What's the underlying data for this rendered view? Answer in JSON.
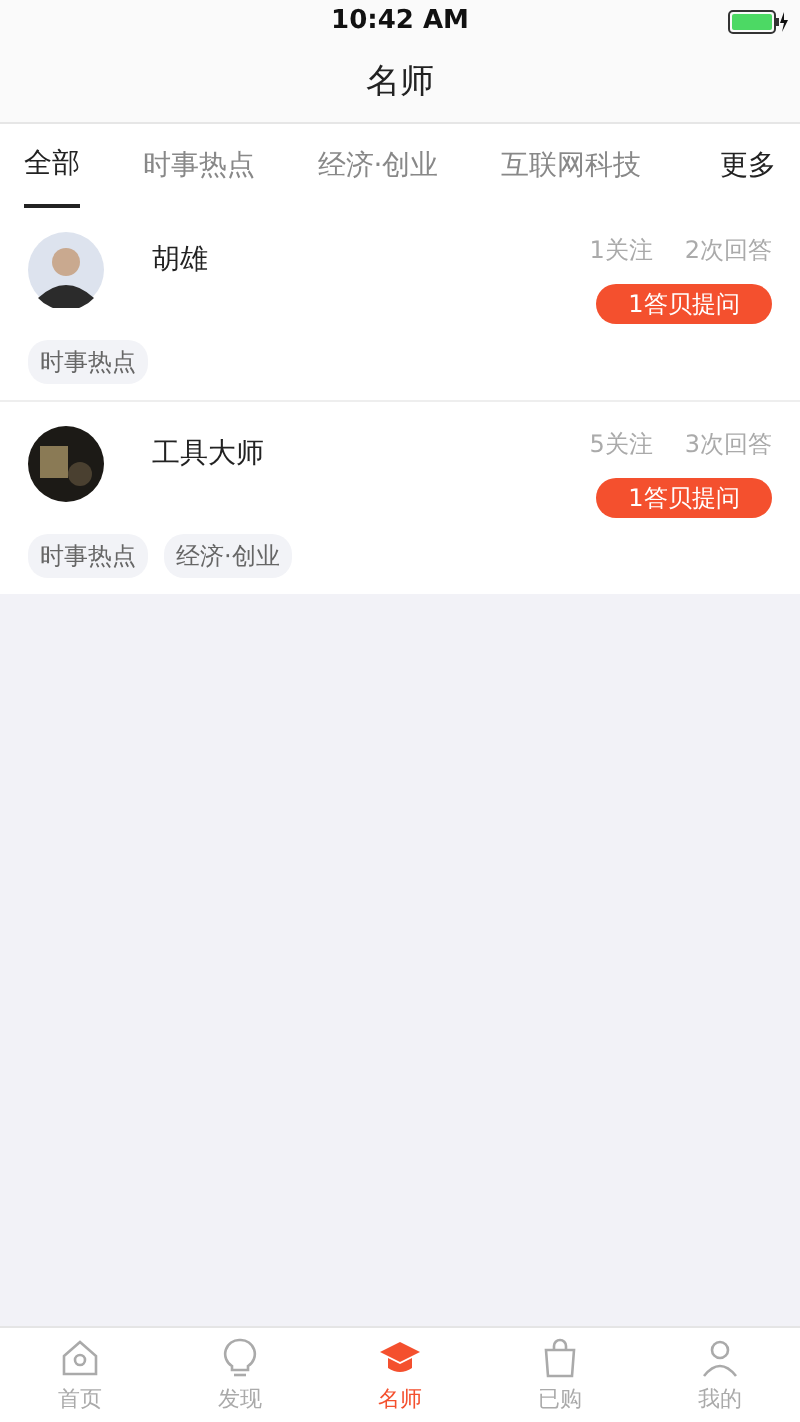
{
  "status_bar": {
    "time": "10:42 AM"
  },
  "header": {
    "title": "名师"
  },
  "category_tabs": [
    {
      "label": "全部",
      "selected": true
    },
    {
      "label": "时事热点",
      "selected": false
    },
    {
      "label": "经济·创业",
      "selected": false
    },
    {
      "label": "互联网科技",
      "selected": false
    }
  ],
  "more_button": "更多",
  "experts": [
    {
      "name": "胡雄",
      "follows": "1关注",
      "answers": "2次回答",
      "ask_button": "1答贝提问",
      "tags": [
        "时事热点"
      ]
    },
    {
      "name": "工具大师",
      "follows": "5关注",
      "answers": "3次回答",
      "ask_button": "1答贝提问",
      "tags": [
        "时事热点",
        "经济·创业"
      ]
    }
  ],
  "bottom_tabs": [
    {
      "label": "首页",
      "selected": false
    },
    {
      "label": "发现",
      "selected": false
    },
    {
      "label": "名师",
      "selected": true
    },
    {
      "label": "已购",
      "selected": false
    },
    {
      "label": "我的",
      "selected": false
    }
  ]
}
